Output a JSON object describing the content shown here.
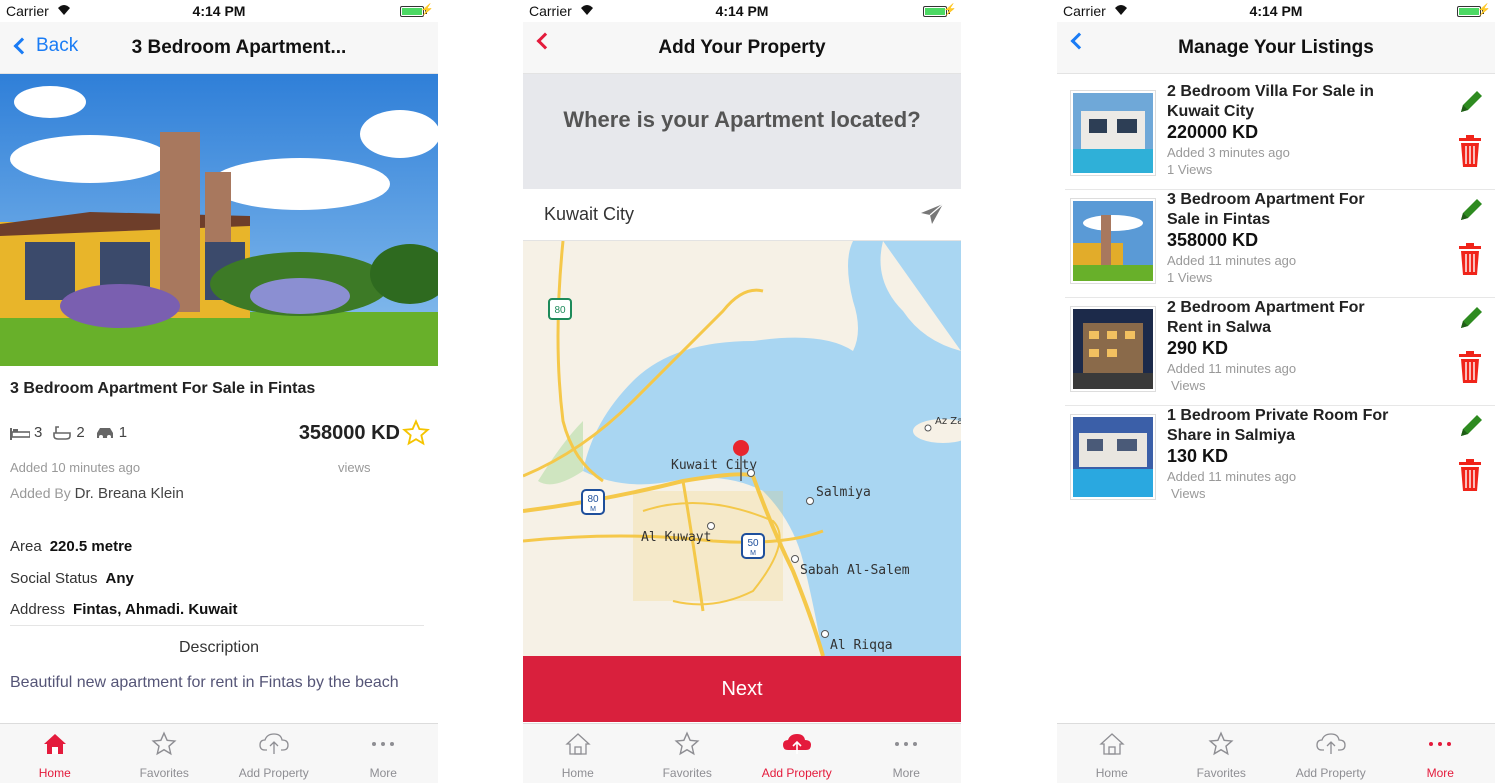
{
  "colors": {
    "accent": "#e41b3c",
    "link": "#1a7cf5",
    "edit": "#2e8b20",
    "delete": "#f0241a"
  },
  "status": {
    "carrier": "Carrier",
    "time": "4:14 PM"
  },
  "screen1": {
    "back_label": "Back",
    "nav_title": "3 Bedroom Apartment...",
    "title": "3 Bedroom Apartment For Sale in Fintas",
    "beds": "3",
    "baths": "2",
    "cars": "1",
    "price": "358000 KD",
    "added": "Added 10 minutes ago",
    "views": "views",
    "added_by_label": "Added By",
    "added_by_name": "Dr. Breana Klein",
    "area_label": "Area",
    "area_value": "220.5 metre",
    "social_label": "Social Status",
    "social_value": "Any",
    "address_label": "Address",
    "address_value": "Fintas, Ahmadi. Kuwait",
    "description_heading": "Description",
    "description": "Beautiful new apartment for rent in Fintas by the beach"
  },
  "screen2": {
    "nav_title": "Add Your Property",
    "question": "Where is your Apartment located?",
    "location_value": "Kuwait City",
    "map_labels": {
      "kuwait_city": "Kuwait City",
      "salmiya": "Salmiya",
      "al_kuwayt": "Al Kuwayt",
      "sabah": "Sabah Al-Salem",
      "al_riqqa": "Al Riqqa",
      "az": "Az Za",
      "r80": "80",
      "r80m": "80",
      "r50m": "50",
      "m": "M"
    },
    "next_label": "Next"
  },
  "screen3": {
    "nav_title": "Manage Your Listings",
    "listings": [
      {
        "title": "2 Bedroom Villa For Sale in Kuwait City",
        "price": "220000 KD",
        "added": "Added 3 minutes ago",
        "views": "1 Views"
      },
      {
        "title": "3 Bedroom Apartment For Sale in Fintas",
        "price": "358000 KD",
        "added": "Added 11 minutes ago",
        "views": "1 Views"
      },
      {
        "title": "2 Bedroom Apartment For Rent in Salwa",
        "price": "290 KD",
        "added": "Added 11 minutes ago",
        "views": "Views"
      },
      {
        "title": "1 Bedroom Private Room For Share in Salmiya",
        "price": "130 KD",
        "added": "Added 11 minutes ago",
        "views": "Views"
      }
    ]
  },
  "tabs": {
    "home": "Home",
    "favorites": "Favorites",
    "add_property": "Add Property",
    "more": "More"
  },
  "active_tabs": {
    "screen1": "home",
    "screen2": "add_property",
    "screen3": "more"
  }
}
